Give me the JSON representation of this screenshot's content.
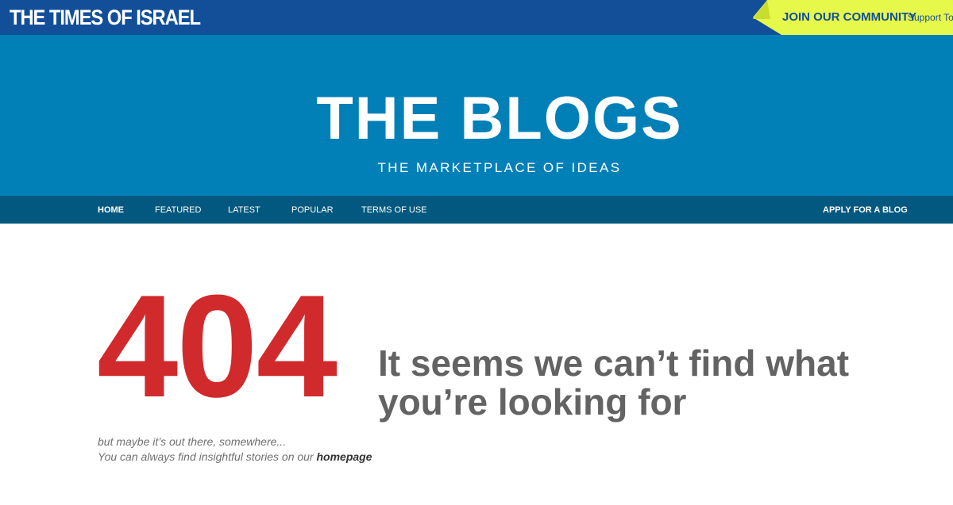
{
  "topbar": {
    "brand": "THE TIMES OF ISRAEL",
    "join_label": "JOIN OUR COMMUNITY",
    "support_label": "Support ToI",
    "colors": {
      "bar": "#134f99",
      "join": "#e6f84a"
    }
  },
  "hero": {
    "title": "THE BLOGS",
    "subtitle": "THE MARKETPLACE OF IDEAS",
    "color": "#0180b8"
  },
  "nav": {
    "items": [
      {
        "label": "HOME",
        "active": true
      },
      {
        "label": "FEATURED"
      },
      {
        "label": "LATEST"
      },
      {
        "label": "POPULAR"
      },
      {
        "label": "TERMS OF USE"
      }
    ],
    "apply_label": "APPLY FOR A BLOG",
    "color": "#03587f"
  },
  "error": {
    "code": "404",
    "headline": "It seems we can’t find what you’re looking for",
    "line1": "but maybe it’s out there, somewhere...",
    "line2_prefix": "You can always find insightful stories on our ",
    "link_label": "homepage",
    "code_color": "#d12a2c"
  }
}
